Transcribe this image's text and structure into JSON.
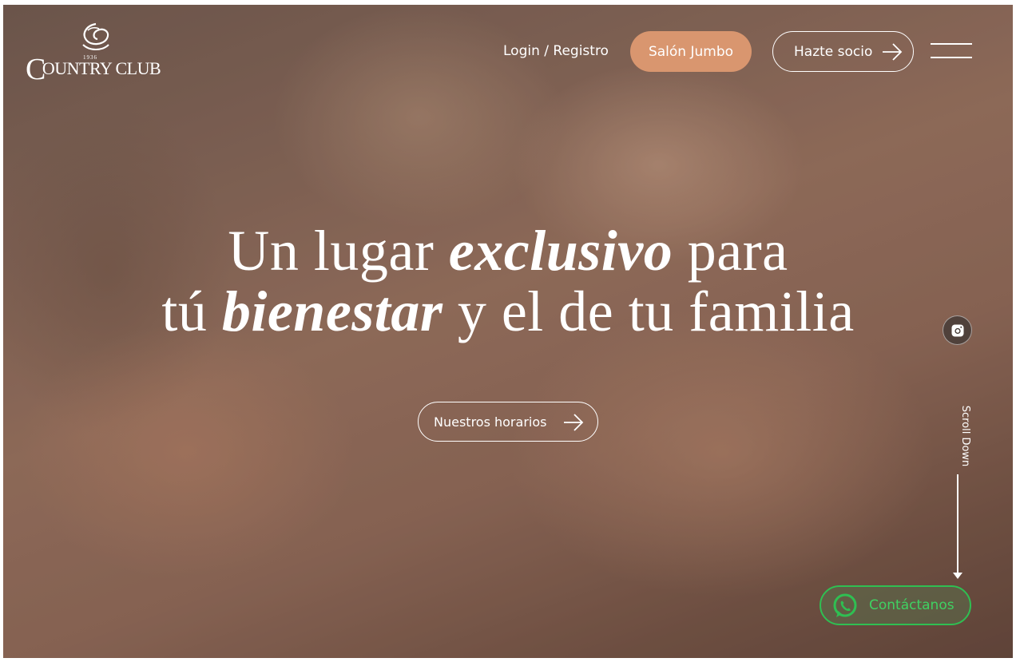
{
  "header": {
    "logo": {
      "year": "1936",
      "initial": "C",
      "rest": "OUNTRY CLUB"
    },
    "nav": {
      "login_label": "Login / Registro",
      "salon_label": "Salón Jumbo",
      "socio_label": "Hazte socio"
    }
  },
  "hero": {
    "line1": {
      "before": "Un lugar ",
      "emphasis": "exclusivo",
      "after": " para"
    },
    "line2": {
      "before": "tú ",
      "emphasis": "bienestar",
      "after": " y el de tu familia"
    },
    "cta_label": "Nuestros horarios"
  },
  "side": {
    "scroll_label": "Scroll Down"
  },
  "contact": {
    "label": "Contáctanos"
  },
  "colors": {
    "accent": "#d9966f",
    "whatsapp": "#2fbf52",
    "text": "#ffffff"
  },
  "icons": [
    "logo-swirl-icon",
    "arrow-right-icon",
    "menu-icon",
    "instagram-icon",
    "arrow-down-icon",
    "whatsapp-icon"
  ]
}
